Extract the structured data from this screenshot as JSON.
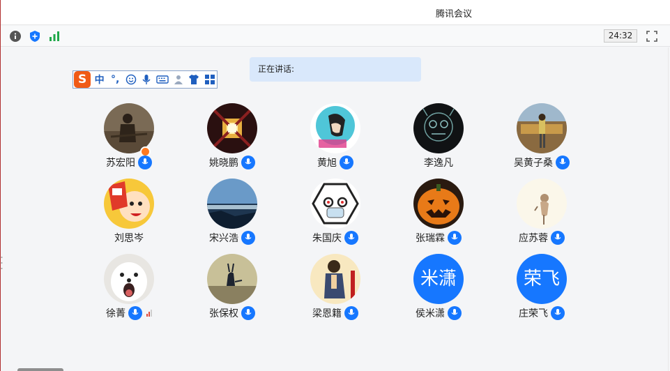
{
  "window": {
    "title": "腾讯会议"
  },
  "toolbar": {
    "info_icon": "info-icon",
    "shield_icon": "shield-icon",
    "signal_icon": "signal-icon",
    "timer": "24:32",
    "fullscreen_icon": "fullscreen-icon"
  },
  "speaking": {
    "label": "正在讲话:"
  },
  "ime": {
    "logo": "S",
    "mode": "中",
    "punct": "°,",
    "icons": [
      "emoji-icon",
      "microphone-icon",
      "keyboard-icon",
      "user-icon",
      "shirt-icon",
      "grid-icon"
    ]
  },
  "colors": {
    "accent": "#1677ff",
    "speaking_bg": "#d9e8fb",
    "host_badge": "#ff7a22",
    "ime_logo": "#f05a16"
  },
  "participants": [
    {
      "name": "苏宏阳",
      "mic": true,
      "host": true
    },
    {
      "name": "姚晓鹏",
      "mic": true
    },
    {
      "name": "黄旭",
      "mic": true
    },
    {
      "name": "李逸凡",
      "mic": false
    },
    {
      "name": "吴黄子桑",
      "mic": true
    },
    {
      "name": "刘思岑",
      "mic": false
    },
    {
      "name": "宋兴浩",
      "mic": true
    },
    {
      "name": "朱国庆",
      "mic": true
    },
    {
      "name": "张瑞霖",
      "mic": true
    },
    {
      "name": "应苏蓉",
      "mic": true
    },
    {
      "name": "徐菁",
      "mic": true,
      "signal": true
    },
    {
      "name": "张保权",
      "mic": true
    },
    {
      "name": "梁恩籍",
      "mic": true
    },
    {
      "name": "侯米潇",
      "mic": true,
      "avatar_text": "米潇"
    },
    {
      "name": "庄荣飞",
      "mic": true,
      "avatar_text": "荣飞"
    }
  ]
}
